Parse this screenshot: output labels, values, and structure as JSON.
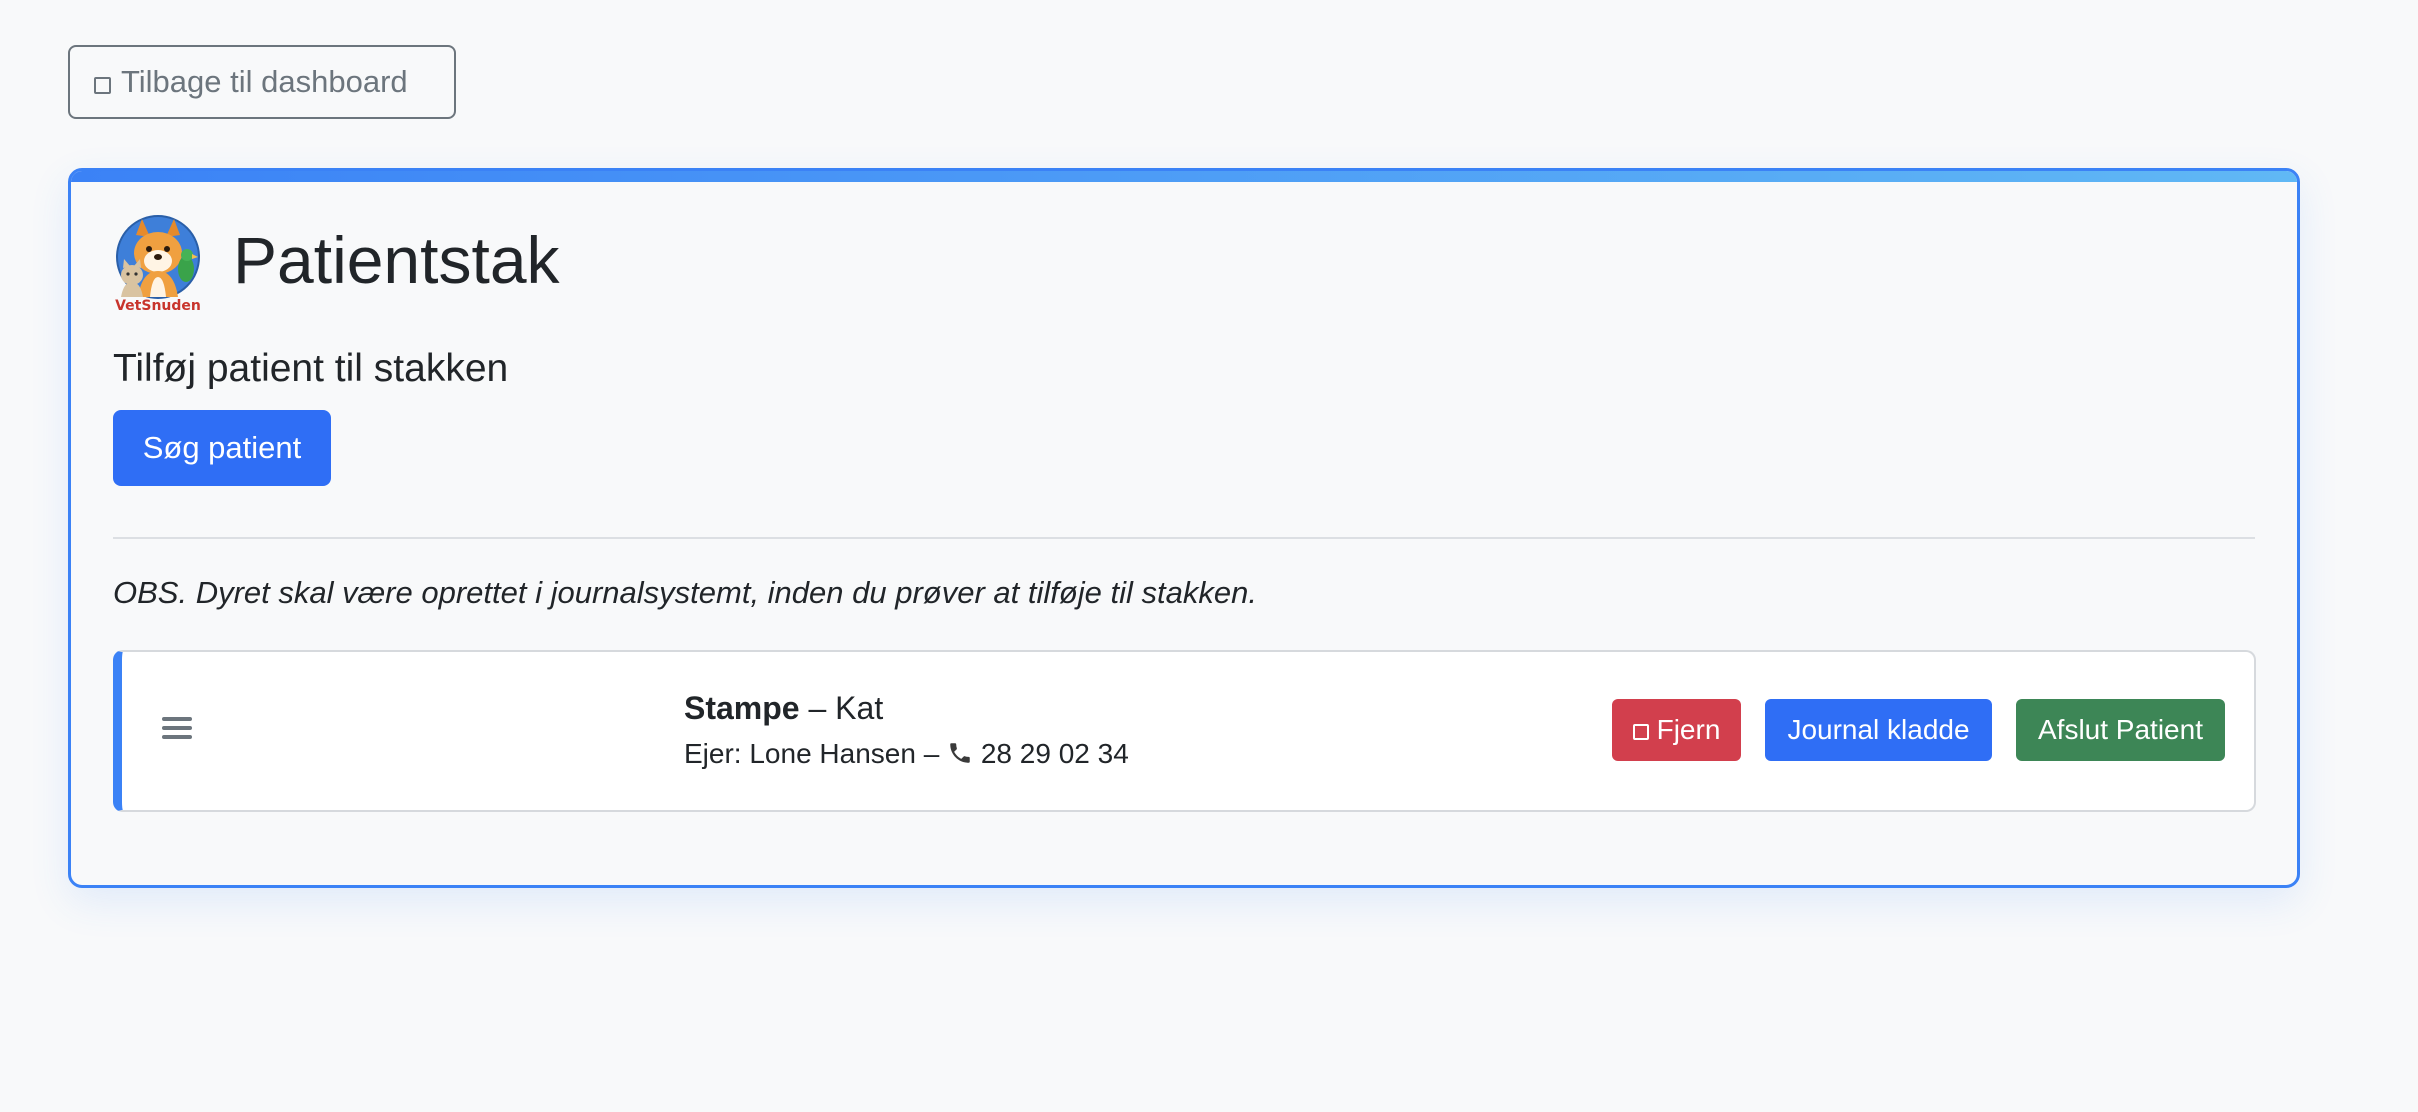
{
  "nav": {
    "back_label": "Tilbage til dashboard"
  },
  "page": {
    "title": "Patientstak",
    "logo_text": "VetSnuden",
    "subtitle": "Tilføj patient til stakken",
    "search_button": "Søg patient",
    "note": "OBS. Dyret skal være oprettet i journalsystemt, inden du prøver at tilføje til stakken."
  },
  "colors": {
    "accent": "#3b82f6",
    "primary_button": "#2f6ef5",
    "danger_button": "#d23f4d",
    "success_button": "#3d8656",
    "background": "#f8f9fa"
  },
  "patients": [
    {
      "name": "Stampe",
      "species_text": " – Kat",
      "owner_prefix": "Ejer: Lone Hansen – ",
      "phone": "28 29 02 34",
      "actions": {
        "remove": "Fjern",
        "journal": "Journal kladde",
        "finish": "Afslut Patient"
      }
    }
  ]
}
